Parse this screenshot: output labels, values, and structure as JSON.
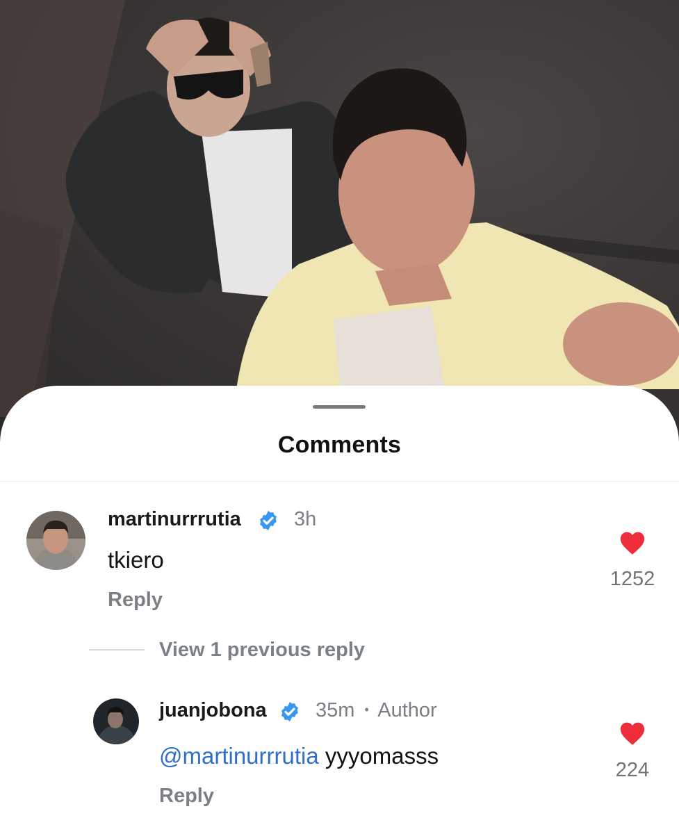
{
  "sheet": {
    "title": "Comments"
  },
  "comments": [
    {
      "username": "martinurrrutia",
      "verified": true,
      "time": "3h",
      "text": "tkiero",
      "reply_label": "Reply",
      "likes": "1252",
      "view_replies_label": "View 1 previous reply"
    },
    {
      "username": "juanjobona",
      "verified": true,
      "time": "35m",
      "separator": "•",
      "author_badge": "Author",
      "mention": "@martinurrrutia",
      "text": "yyyomasss",
      "reply_label": "Reply",
      "likes": "224"
    }
  ],
  "icons": {
    "verified": "verified-check-icon",
    "like": "heart-icon",
    "handle": "drag-handle"
  },
  "colors": {
    "verified_blue": "#3897f0",
    "heart_red": "#ee2d3a",
    "mention_blue": "#2f6fc9"
  }
}
